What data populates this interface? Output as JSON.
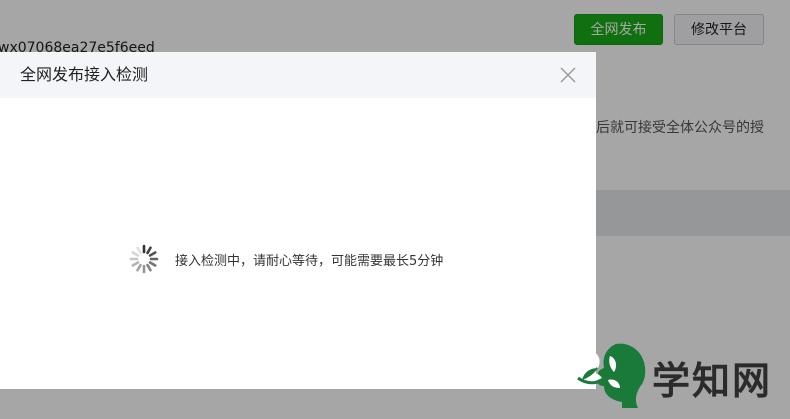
{
  "background": {
    "app_id": "wx07068ea27e5f6eed",
    "publish_button": "全网发布",
    "modify_button": "修改平台",
    "description_fragment": "后就可接受全体公众号的授"
  },
  "dialog": {
    "title": "全网发布接入检测",
    "loading_text": "接入检测中，请耐心等待，可能需要最长5分钟"
  },
  "watermark": {
    "text": "学知网"
  },
  "colors": {
    "primary_green": "#1aad19",
    "dialog_header_bg": "#f4f5f9",
    "watermark_green": "#1a7a3a"
  }
}
